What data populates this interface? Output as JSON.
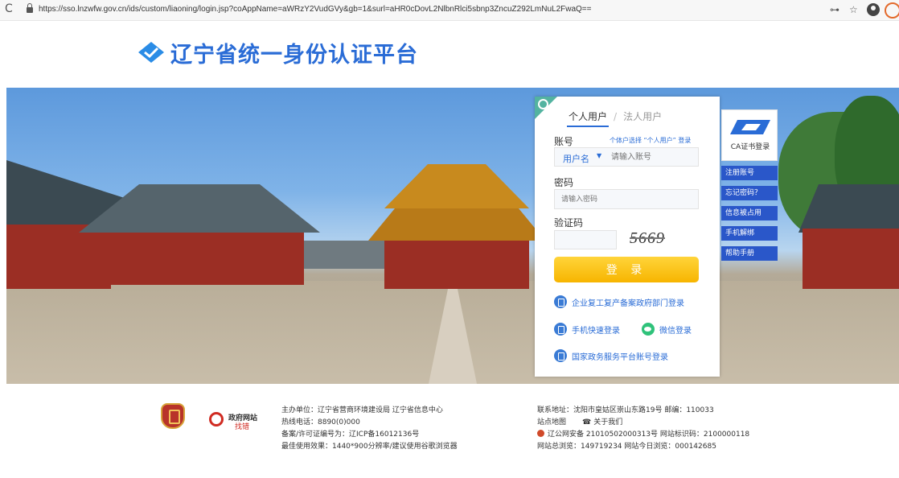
{
  "browser": {
    "url": "https://sso.lnzwfw.gov.cn/ids/custom/liaoning/login.jsp?coAppName=aWRzY2VudGVy&gb=1&surl=aHR0cDovL2NlbnRlci5sbnp3ZncuZ292LmNuL2FwaQ==",
    "reload_icon": "reload-icon",
    "key_icon": "key-icon",
    "star_icon": "star-icon"
  },
  "header": {
    "title": "辽宁省统一身份认证平台"
  },
  "login": {
    "tab_personal": "个人用户",
    "tab_separator": "/",
    "tab_legal": "法人用户",
    "account_label": "账号",
    "account_hint": "个体户选择 “个人用户” 登录",
    "account_type": "用户名",
    "account_placeholder": "请输入账号",
    "password_label": "密码",
    "password_placeholder": "请输入密码",
    "captcha_label": "验证码",
    "captcha_text": "5669",
    "login_button": "登 录",
    "alt_enterprise": "企业复工复产备案政府部门登录",
    "alt_mobile": "手机快速登录",
    "alt_wechat": "微信登录",
    "alt_national": "国家政务服务平台账号登录"
  },
  "side": {
    "ca_label": "CA证书登录",
    "register": "注册账号",
    "forgot": "忘记密码？",
    "occupied": "信息被占用",
    "unbind": "手机解绑",
    "help": "帮助手册"
  },
  "footer": {
    "gov_site_1": "政府网站",
    "gov_site_2": "找错",
    "host": "主办单位：辽宁省营商环境建设局   辽宁省信息中心",
    "hotline": "热线电话：8890(0)000",
    "icp": "备案/许可证编号为：辽ICP备16012136号",
    "best": "最佳使用效果：1440*900分辨率/建议使用谷歌浏览器",
    "address": "联系地址：沈阳市皇姑区崇山东路19号   邮编：110033",
    "sitemap": "站点地图",
    "about": "关于我们",
    "police": "辽公网安备 21010502000313号 网站标识码：2100000118",
    "visits": "网站总浏览：149719234    网站今日浏览：000142685"
  },
  "colors": {
    "brand_blue": "#2a6cd6",
    "login_yellow": "#f7b500",
    "side_blue": "#2a57c9"
  }
}
